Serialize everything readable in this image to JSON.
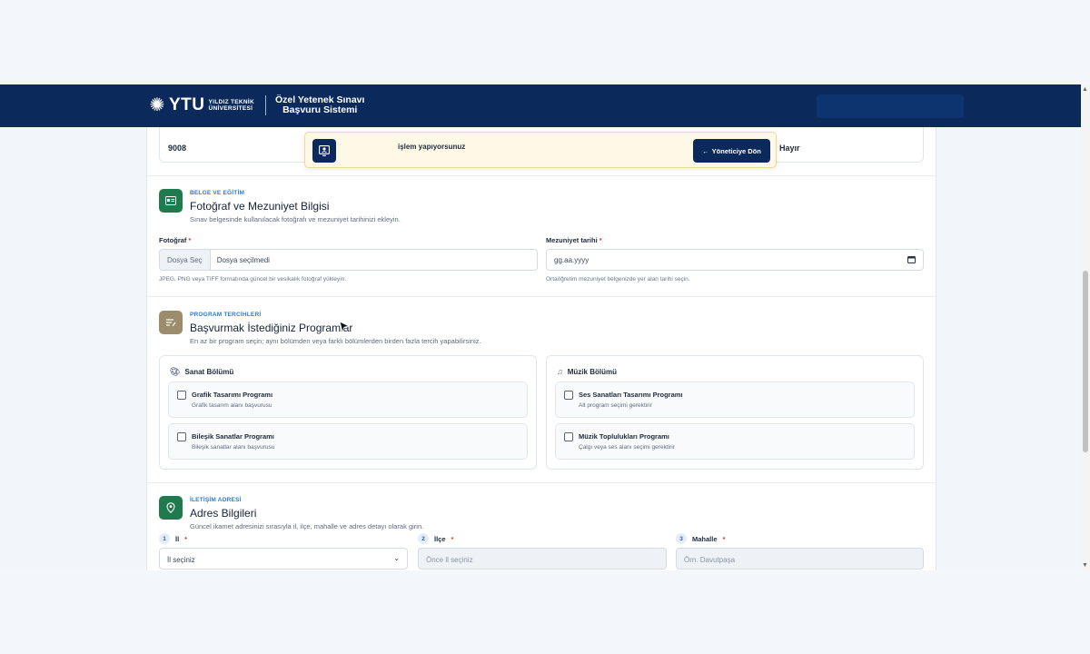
{
  "header": {
    "logo_abbr": "YTU",
    "logo_uni_line1": "YILDIZ TEKNİK",
    "logo_uni_line2": "ÜNİVERSİTESİ",
    "title_line1": "Özel Yetenek Sınavı",
    "title_line2": "Başvuru Sistemi"
  },
  "toast": {
    "message": "işlem yapıyorsunuz",
    "back_button": "Yöneticiye Dön",
    "back_arrow": "←"
  },
  "summary": {
    "value_left": "9008",
    "value_right": "Hayır"
  },
  "photo_section": {
    "eyebrow": "BELGE VE EĞİTİM",
    "title": "Fotoğraf ve Mezuniyet Bilgisi",
    "subtitle": "Sınav belgesinde kullanılacak fotoğrafı ve mezuniyet tarihinizi ekleyin.",
    "photo_label": "Fotoğraf",
    "file_button": "Dosya Seç",
    "file_status": "Dosya seçilmedi",
    "photo_hint": "JPEG, PNG veya TIFF formatında güncel bir vesikalık fotoğraf yükleyin.",
    "grad_label": "Mezuniyet tarihi",
    "grad_placeholder": "gg.aa.yyyy",
    "grad_hint": "Ortaöğretim mezuniyet belgenizde yer alan tarihi seçin.",
    "required_mark": "*"
  },
  "program_section": {
    "eyebrow": "PROGRAM TERCİHLERİ",
    "title": "Başvurmak İstediğiniz Programlar",
    "subtitle": "En az bir program seçin; aynı bölümden veya farklı bölümlerden birden fazla tercih yapabilirsiniz.",
    "groups": [
      {
        "title": "Sanat Bölümü",
        "icon": "palette-icon",
        "programs": [
          {
            "name": "Grafik Tasarımı Programı",
            "desc": "Grafik tasarım alanı başvurusu"
          },
          {
            "name": "Bileşik Sanatlar Programı",
            "desc": "Bileşik sanatlar alanı başvurusu"
          }
        ]
      },
      {
        "title": "Müzik Bölümü",
        "icon": "music-note-icon",
        "programs": [
          {
            "name": "Ses Sanatları Tasarımı Programı",
            "desc": "Alt program seçimi gerektirir"
          },
          {
            "name": "Müzik Toplulukları Programı",
            "desc": "Çalgı veya ses alanı seçimi gerektirir"
          }
        ]
      }
    ]
  },
  "address_section": {
    "eyebrow": "İLETİŞİM ADRESİ",
    "title": "Adres Bilgileri",
    "subtitle": "Güncel ikamet adresinizi sırasıyla il, ilçe, mahalle ve adres detayı olarak girin.",
    "fields": [
      {
        "num": "1",
        "label": "İl",
        "value": "İl seçiniz"
      },
      {
        "num": "2",
        "label": "İlçe",
        "value": "Önce il seçiniz"
      },
      {
        "num": "3",
        "label": "Mahalle",
        "value": "Örn. Davutpaşa"
      }
    ]
  },
  "colors": {
    "header_bg": "#0b2a5b",
    "accent_blue": "#2a7ad8",
    "icon_green": "#1f7a4d",
    "icon_khaki": "#9b8d6c",
    "toast_bg": "#fef8e6"
  }
}
